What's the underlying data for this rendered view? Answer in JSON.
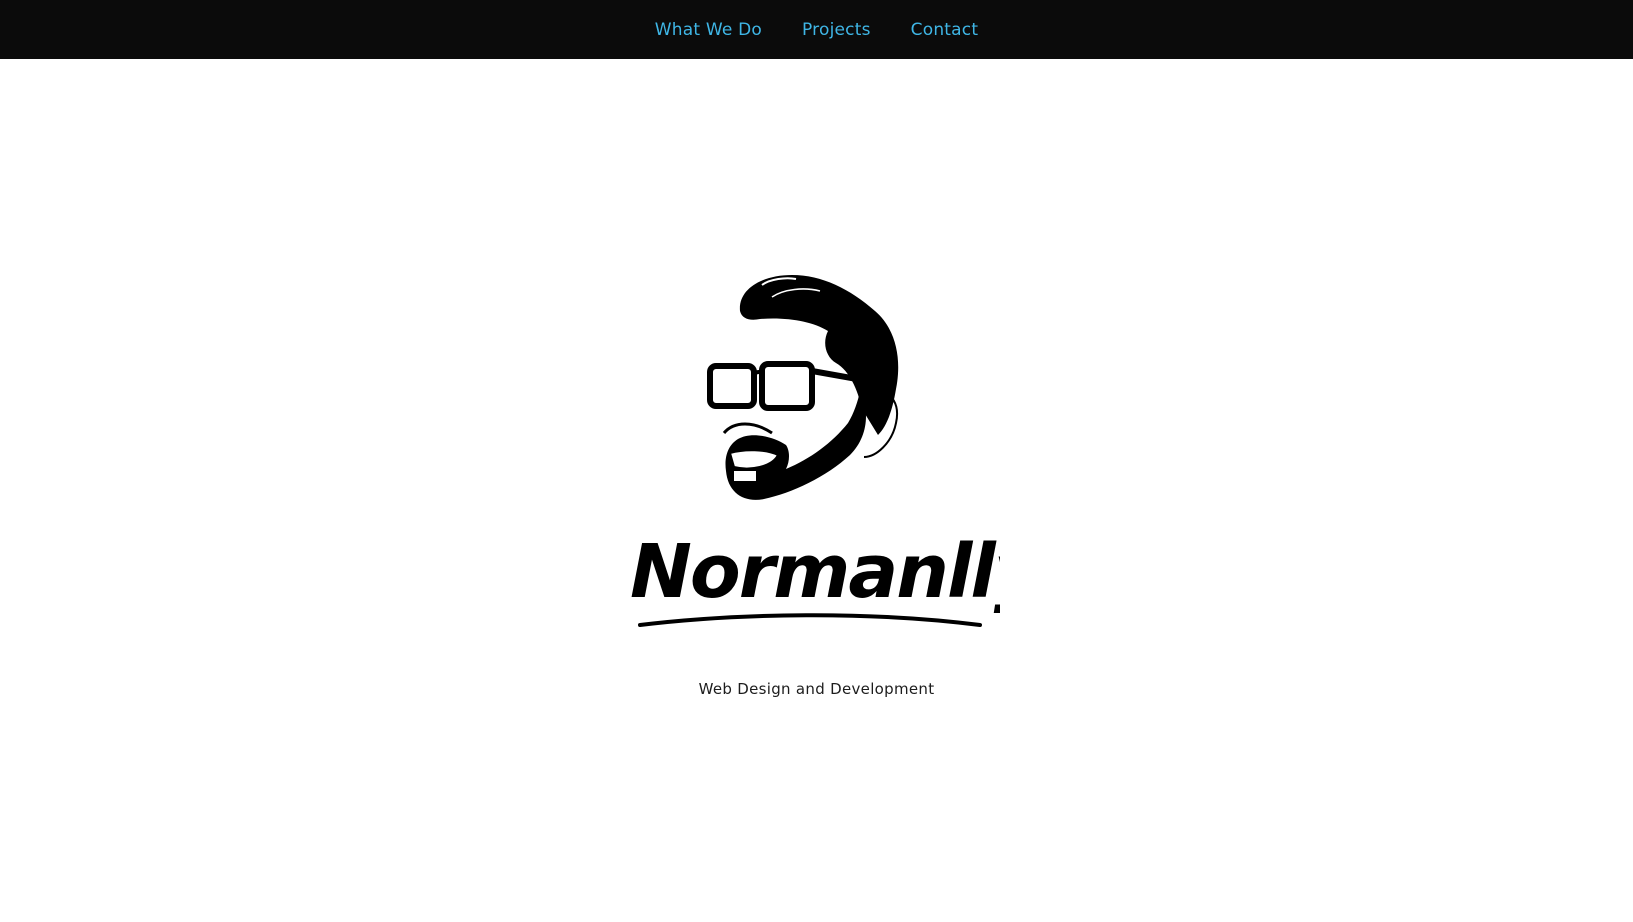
{
  "nav": {
    "items": [
      {
        "label": "What We Do"
      },
      {
        "label": "Projects"
      },
      {
        "label": "Contact"
      }
    ],
    "link_color": "#3fb6e6",
    "background": "#0b0b0b"
  },
  "hero": {
    "logo_wordmark": "Normanlly",
    "logo_icon": "bearded-man-with-glasses-icon",
    "tagline": "Web Design and Development"
  }
}
